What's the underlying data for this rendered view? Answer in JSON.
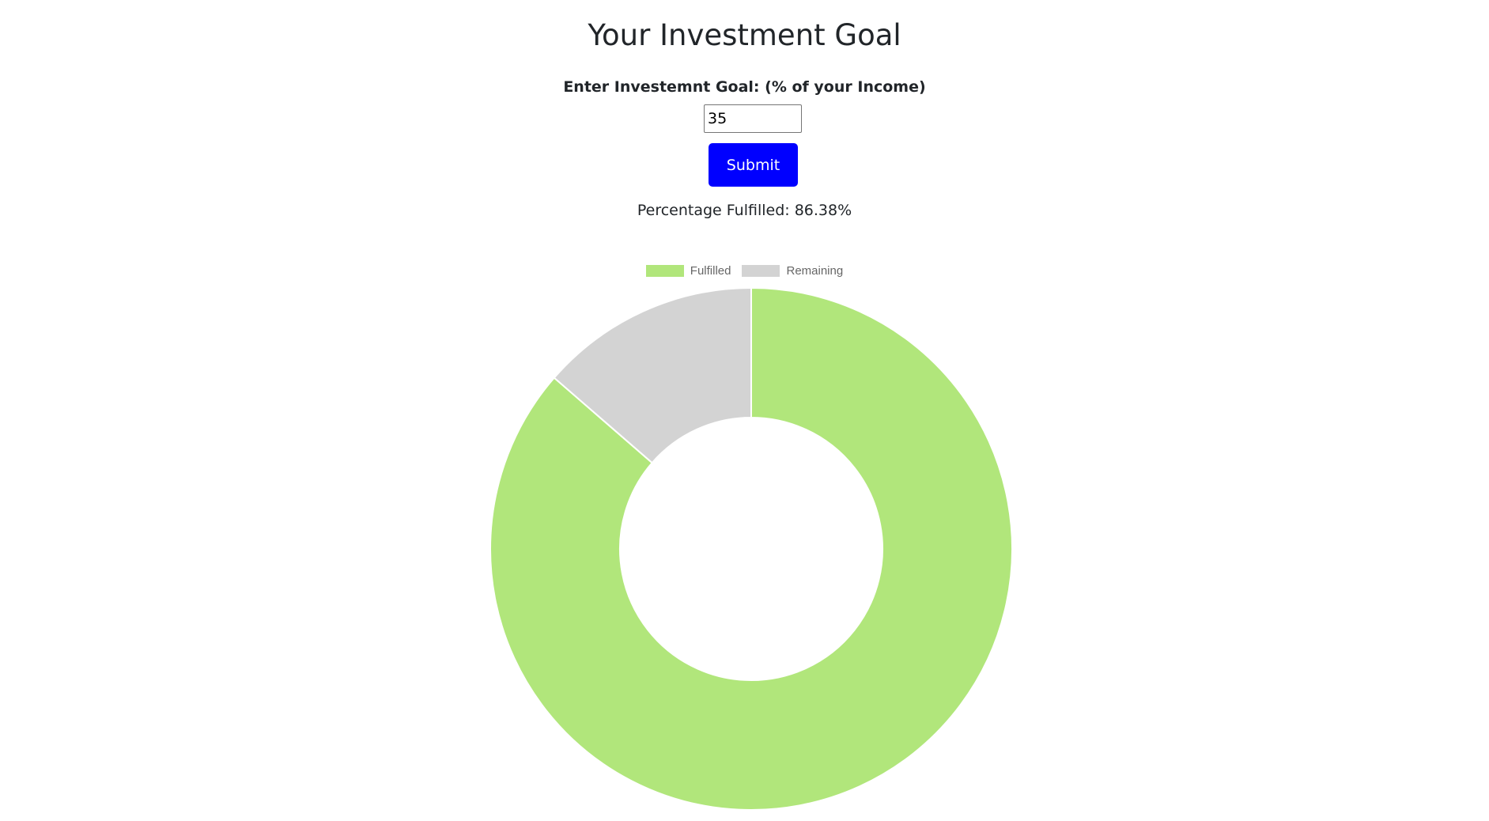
{
  "page": {
    "title": "Your Investment Goal"
  },
  "form": {
    "label": "Enter Investemnt Goal: (% of your Income)",
    "input_value": "35",
    "submit_label": "Submit"
  },
  "result": {
    "text": "Percentage Fulfilled: 86.38%"
  },
  "colors": {
    "fulfilled": "#b1e67b",
    "remaining": "#d3d3d3",
    "submit_bg": "#0000ff"
  },
  "chart_data": {
    "type": "doughnut",
    "categories": [
      "Fulfilled",
      "Remaining"
    ],
    "values": [
      86.38,
      13.62
    ],
    "colors": [
      "#b1e67b",
      "#d3d3d3"
    ],
    "legend_position": "top"
  }
}
